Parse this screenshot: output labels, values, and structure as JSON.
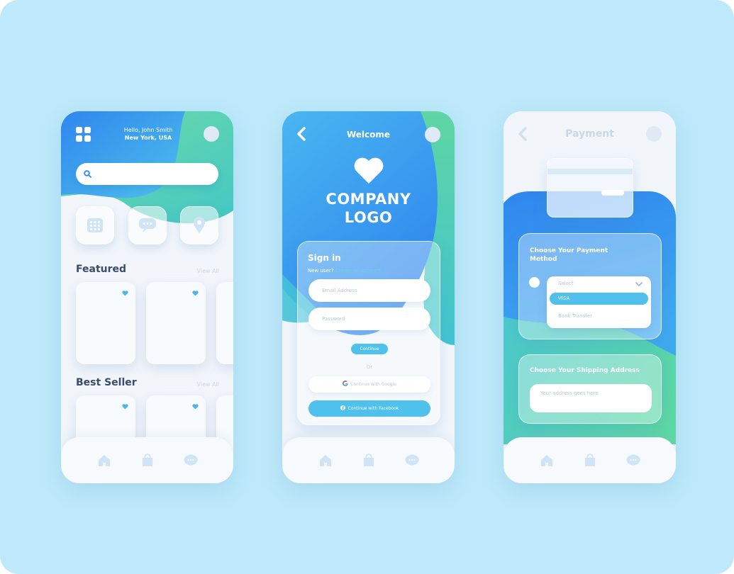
{
  "screens": {
    "home": {
      "greeting": "Hello, John Smith",
      "location": "New York, USA",
      "search": {
        "placeholder": ""
      },
      "categories": [
        {
          "icon": "calendar-grid-icon"
        },
        {
          "icon": "chat-bubble-icon"
        },
        {
          "icon": "location-pin-icon"
        }
      ],
      "featured": {
        "title": "Featured",
        "view_all": "View All"
      },
      "best_seller": {
        "title": "Best Seller",
        "view_all": "View All"
      }
    },
    "signin": {
      "header_title": "Welcome",
      "logo_line1": "COMPANY",
      "logo_line2": "LOGO",
      "form_title": "Sign in",
      "new_user_text": "New user?",
      "create_account_link": "Create an account",
      "email_placeholder": "Email Address",
      "password_placeholder": "Password",
      "continue_label": "Continue",
      "or_label": "Or",
      "google_label": "Continue with Google",
      "facebook_label": "Continue with Facebook"
    },
    "payment": {
      "header_title": "Payment",
      "method_title": "Choose Your Payment Method",
      "select_placeholder": "Select",
      "options": [
        "VISA",
        "Bank Transfer"
      ],
      "selected_option": "VISA",
      "shipping_title": "Choose Your Shipping Address",
      "address_placeholder": "Your address goes here"
    }
  },
  "nav_icons": [
    "home-icon",
    "bag-icon",
    "chat-icon"
  ],
  "colors": {
    "background": "#bde9fa",
    "primary_blue": "#2f86ee",
    "accent_green": "#5dd39e",
    "light_blue": "#4fc1ec",
    "text_dark": "#3a4b6b"
  }
}
